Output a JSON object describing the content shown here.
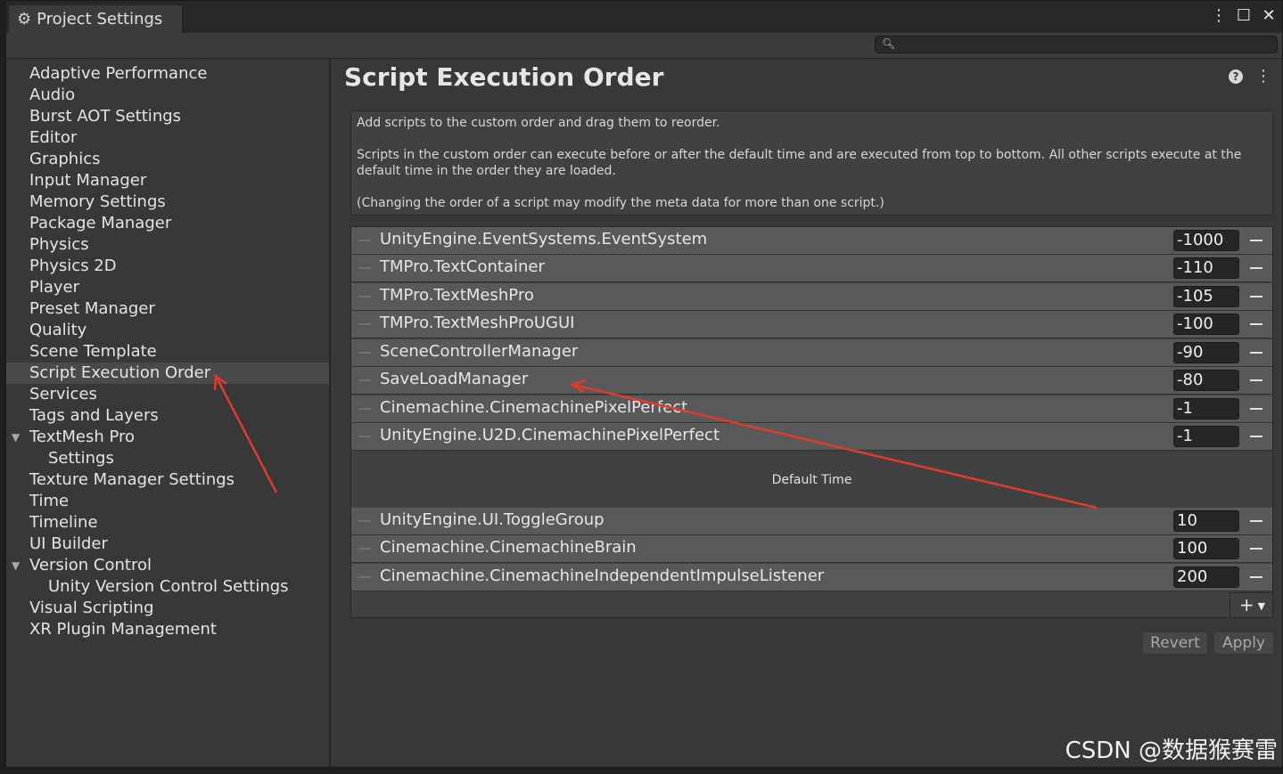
{
  "window": {
    "tab_label": "Project Settings",
    "tab_icon": "gear-icon",
    "title_icons": [
      "kebab-menu-icon",
      "maximize-icon",
      "close-icon"
    ],
    "search": {
      "placeholder": "",
      "value": ""
    }
  },
  "sidebar": {
    "selected": "Script Execution Order",
    "items": [
      {
        "label": "Adaptive Performance"
      },
      {
        "label": "Audio"
      },
      {
        "label": "Burst AOT Settings"
      },
      {
        "label": "Editor"
      },
      {
        "label": "Graphics"
      },
      {
        "label": "Input Manager"
      },
      {
        "label": "Memory Settings"
      },
      {
        "label": "Package Manager"
      },
      {
        "label": "Physics"
      },
      {
        "label": "Physics 2D"
      },
      {
        "label": "Player"
      },
      {
        "label": "Preset Manager"
      },
      {
        "label": "Quality"
      },
      {
        "label": "Scene Template"
      },
      {
        "label": "Script Execution Order"
      },
      {
        "label": "Services"
      },
      {
        "label": "Tags and Layers"
      },
      {
        "label": "TextMesh Pro"
      },
      {
        "label": "Settings"
      },
      {
        "label": "Texture Manager Settings"
      },
      {
        "label": "Time"
      },
      {
        "label": "Timeline"
      },
      {
        "label": "UI Builder"
      },
      {
        "label": "Version Control"
      },
      {
        "label": "Unity Version Control Settings"
      },
      {
        "label": "Visual Scripting"
      },
      {
        "label": "XR Plugin Management"
      }
    ]
  },
  "main": {
    "title": "Script Execution Order",
    "help": {
      "line1": "Add scripts to the custom order and drag them to reorder.",
      "line2": "Scripts in the custom order can execute before or after the default time and are executed from top to bottom. All other scripts execute at the default time in the order they are loaded.",
      "line3": "(Changing the order of a script may modify the meta data for more than one script.)"
    },
    "scripts_before": [
      {
        "name": "UnityEngine.EventSystems.EventSystem",
        "order": "-1000"
      },
      {
        "name": "TMPro.TextContainer",
        "order": "-110"
      },
      {
        "name": "TMPro.TextMeshPro",
        "order": "-105"
      },
      {
        "name": "TMPro.TextMeshProUGUI",
        "order": "-100"
      },
      {
        "name": "SceneControllerManager",
        "order": "-90"
      },
      {
        "name": "SaveLoadManager",
        "order": "-80"
      },
      {
        "name": "Cinemachine.CinemachinePixelPerfect",
        "order": "-1"
      },
      {
        "name": "UnityEngine.U2D.CinemachinePixelPerfect",
        "order": "-1"
      }
    ],
    "default_time_label": "Default Time",
    "scripts_after": [
      {
        "name": "UnityEngine.UI.ToggleGroup",
        "order": "10"
      },
      {
        "name": "Cinemachine.CinemachineBrain",
        "order": "100"
      },
      {
        "name": "Cinemachine.CinemachineIndependentImpulseListener",
        "order": "200"
      }
    ],
    "add_label": "+",
    "revert_label": "Revert",
    "apply_label": "Apply"
  },
  "watermark": "CSDN @数据猴赛雷",
  "colors": {
    "annotation_arrow": "#e03c2a",
    "selected_item": "#4a4a4a",
    "row": "#595959"
  }
}
